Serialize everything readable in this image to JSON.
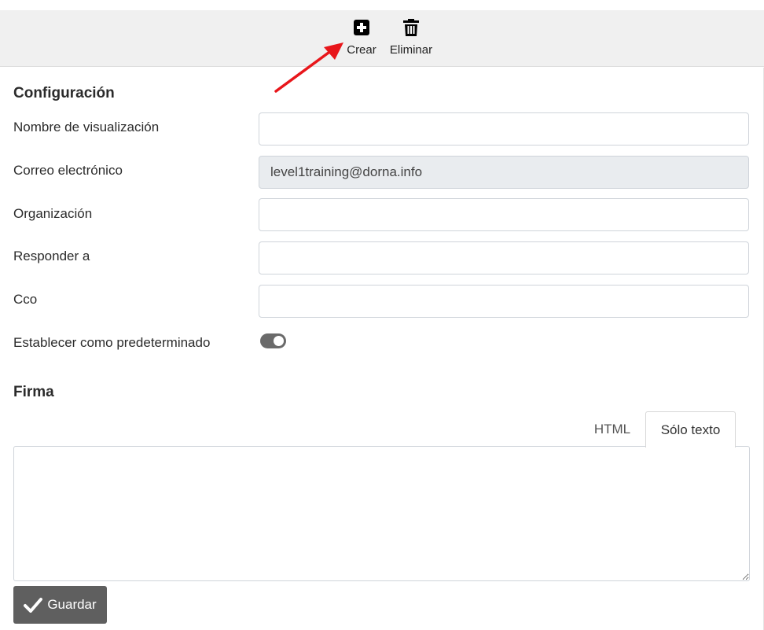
{
  "toolbar": {
    "create_label": "Crear",
    "delete_label": "Eliminar"
  },
  "config": {
    "title": "Configuración",
    "fields": {
      "display_name": {
        "label": "Nombre de visualización",
        "value": ""
      },
      "email": {
        "label": "Correo electrónico",
        "value": "level1training@dorna.info"
      },
      "organization": {
        "label": "Organización",
        "value": ""
      },
      "reply_to": {
        "label": "Responder a",
        "value": ""
      },
      "bcc": {
        "label": "Cco",
        "value": ""
      }
    },
    "default_toggle": {
      "label": "Establecer como predeterminado",
      "on": true
    }
  },
  "signature": {
    "title": "Firma",
    "tabs": [
      "HTML",
      "Sólo texto"
    ],
    "active_tab": "Sólo texto",
    "text": ""
  },
  "footer": {
    "save_label": "Guardar"
  },
  "colors": {
    "toolbar_bg": "#f0f0f0",
    "readonly_bg": "#e9ecef",
    "toggle_on": "#6a6a6a",
    "save_button": "#5f5f5f",
    "annotation_arrow": "#e8161b"
  },
  "icons": {
    "create": "plus-square-icon",
    "delete": "trash-icon",
    "save": "check-icon"
  }
}
